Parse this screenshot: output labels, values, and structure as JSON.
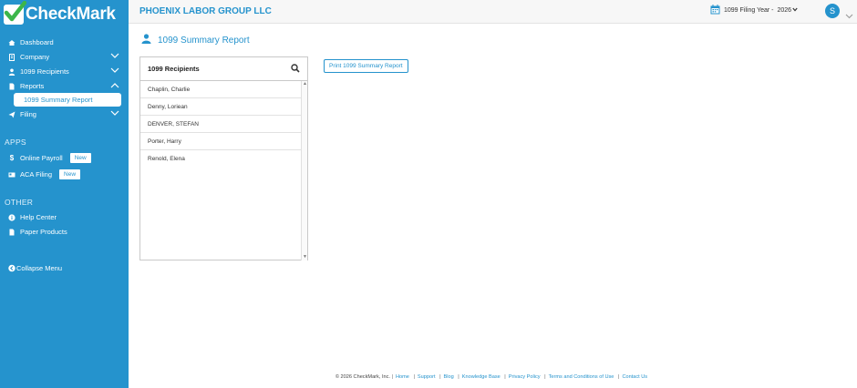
{
  "app": {
    "logo_text": "CheckMark"
  },
  "sidebar": {
    "items": [
      {
        "label": "Dashboard"
      },
      {
        "label": "Company"
      },
      {
        "label": "1099 Recipients"
      },
      {
        "label": "Reports"
      },
      {
        "label": "1099 Summary Report"
      },
      {
        "label": "Filing"
      }
    ],
    "apps_label": "APPS",
    "apps": [
      {
        "label": "Online Payroll",
        "badge": "New"
      },
      {
        "label": "ACA Filing",
        "badge": "New"
      }
    ],
    "other_label": "OTHER",
    "other": [
      {
        "label": "Help Center"
      },
      {
        "label": "Paper Products"
      }
    ],
    "collapse_label": "Collapse Menu"
  },
  "header": {
    "company": "PHOENIX LABOR GROUP LLC",
    "filing_year_label": "1099 Filing Year -",
    "filing_year_value": "2026",
    "avatar_initial": "S"
  },
  "page": {
    "title": "1099 Summary Report",
    "panel_title": "1099 Recipients",
    "recipients": [
      "Chaplin, Charlie",
      "Denny, Loriean",
      "DENVER, STEFAN",
      "Porter, Harry",
      "Renold, Elena"
    ],
    "print_button": "Print 1099 Summary Report"
  },
  "footer": {
    "copyright": "© 2026 CheckMark, Inc.",
    "links": [
      "Home",
      "Support",
      "Blog",
      "Knowledge Base",
      "Privacy Policy",
      "Terms and Conditions of Use",
      "Contact Us"
    ]
  },
  "colors": {
    "brand": "#2593cd",
    "header_bg": "#f7f7f7"
  },
  "icons": [
    "home-icon",
    "building-icon",
    "user-icon",
    "report-icon",
    "paper-plane-icon",
    "dollar-icon",
    "id-card-icon",
    "info-icon",
    "document-icon",
    "collapse-icon",
    "calendar-icon",
    "search-icon",
    "chevron-down-icon",
    "chevron-up-icon"
  ]
}
